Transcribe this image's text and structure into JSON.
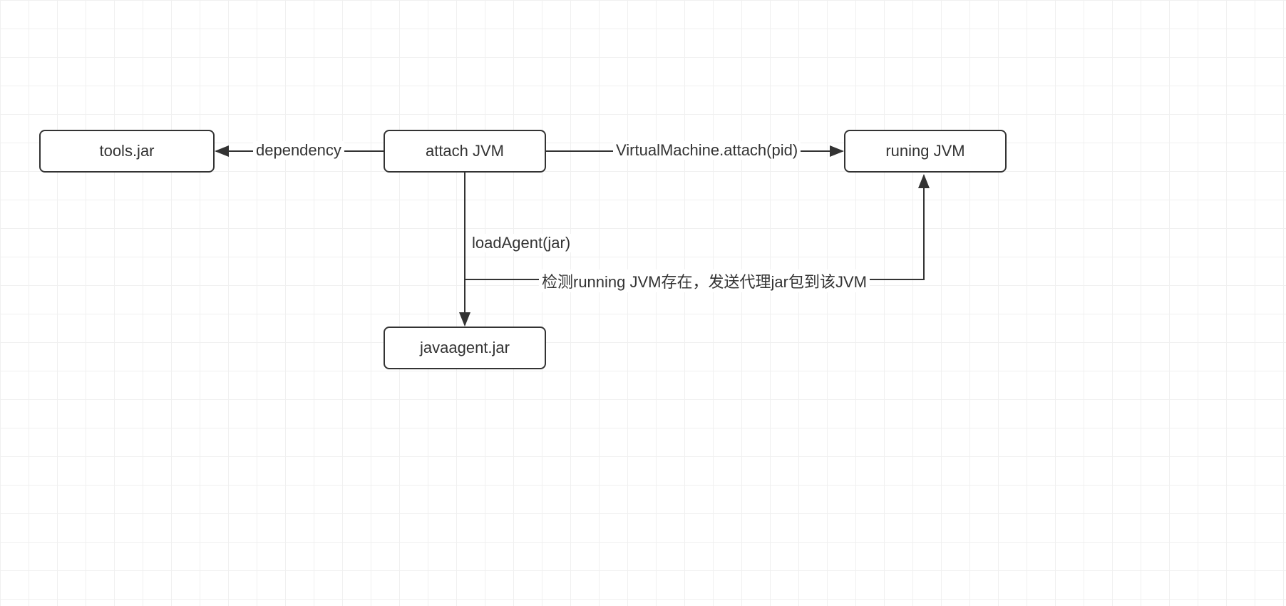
{
  "nodes": {
    "tools_jar": "tools.jar",
    "attach_jvm": "attach JVM",
    "running_jvm": "runing JVM",
    "javaagent_jar": "javaagent.jar"
  },
  "edges": {
    "dependency": "dependency",
    "virtual_machine_attach": "VirtualMachine.attach(pid)",
    "load_agent": "loadAgent(jar)",
    "send_agent": "检测running JVM存在，发送代理jar包到该JVM"
  }
}
